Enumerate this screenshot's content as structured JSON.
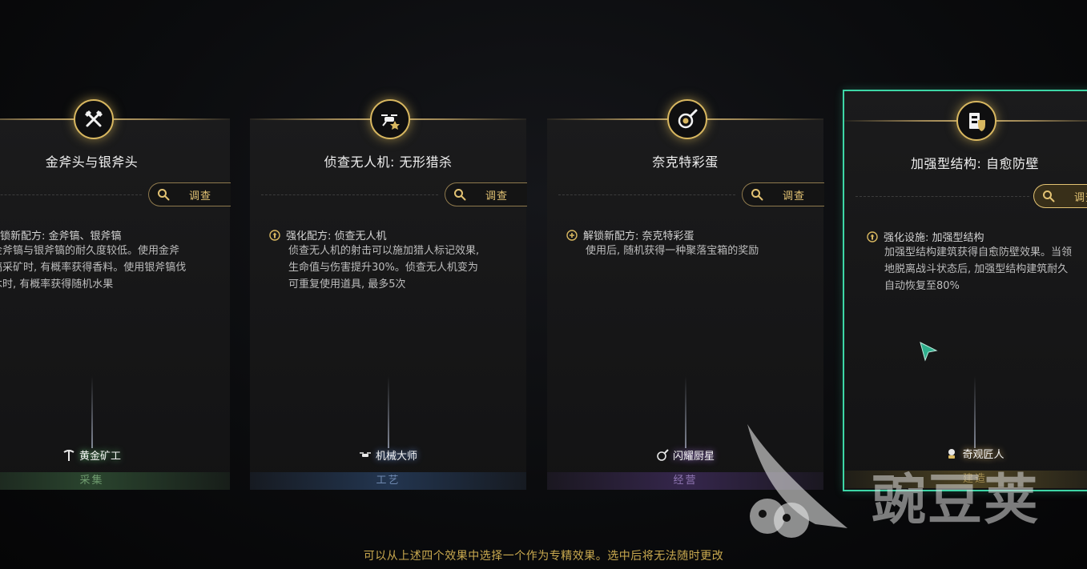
{
  "cards": [
    {
      "title": "金斧头与银斧头",
      "investigate_label": "调查",
      "effect_label": "解锁新配方: 金斧镐、银斧镐",
      "effect_icon": "plus-circle-icon",
      "effect_desc": "金斧镐与银斧镐的耐久度较低。使用金斧\n镐采矿时, 有概率获得香料。使用银斧镐伐\n木时, 有概率获得随机水果",
      "rank": "黄金矿工",
      "rank_icon": "pickaxe-icon",
      "category": "采集",
      "category_color": "#6f9c6f",
      "emblem_icon": "crossed-axes-icon"
    },
    {
      "title": "侦查无人机: 无形猎杀",
      "investigate_label": "调查",
      "effect_label": "强化配方: 侦查无人机",
      "effect_icon": "upgrade-icon",
      "effect_desc": "侦查无人机的射击可以施加猎人标记效果,\n生命值与伤害提升30%。侦查无人机变为\n可重复使用道具, 最多5次",
      "rank": "机械大师",
      "rank_icon": "drone-icon",
      "category": "工艺",
      "category_color": "#6f89b0",
      "emblem_icon": "drone-icon"
    },
    {
      "title": "奈克特彩蛋",
      "investigate_label": "调查",
      "effect_label": "解锁新配方: 奈克特彩蛋",
      "effect_icon": "plus-circle-icon",
      "effect_desc": "使用后, 随机获得一种聚落宝箱的奖励",
      "rank": "闪耀厨星",
      "rank_icon": "frying-pan-icon",
      "category": "经营",
      "category_color": "#8f76b2",
      "emblem_icon": "frying-pan-icon"
    },
    {
      "title": "加强型结构: 自愈防壁",
      "investigate_label": "调查",
      "effect_label": "强化设施: 加强型结构",
      "effect_icon": "upgrade-icon",
      "effect_desc": "加强型结构建筑获得自愈防壁效果。当领\n地脱离战斗状态后, 加强型结构建筑耐久\n自动恢复至80%",
      "rank": "奇观匠人",
      "rank_icon": "builder-icon",
      "category": "建造",
      "category_color": "#a08a4f",
      "emblem_icon": "shielded-structure-icon"
    }
  ],
  "footer_text": "可以从上述四个效果中选择一个作为专精效果。选中后将无法随时更改",
  "watermark_text": "豌豆荚",
  "selection_color": "#3dd6a6",
  "accent_gold": "#e2c273"
}
